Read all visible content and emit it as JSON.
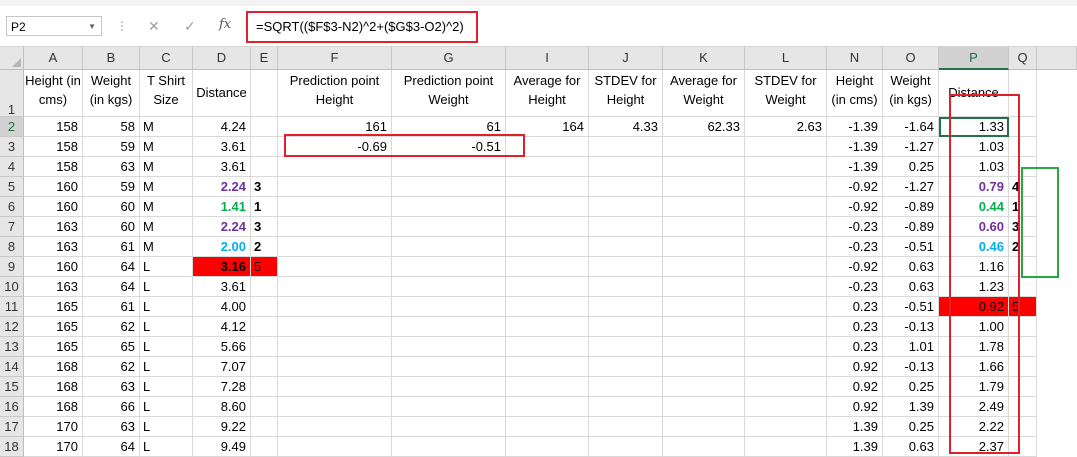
{
  "namebox": {
    "value": "P2"
  },
  "formula_bar": {
    "fx_label": "fx",
    "formula": "=SQRT(($F$3-N2)^2+($G$3-O2)^2)",
    "cancel_icon": "x-icon",
    "enter_icon": "check-icon",
    "highlight_color": "#e0202a"
  },
  "columns": [
    "A",
    "B",
    "C",
    "D",
    "E",
    "F",
    "G",
    "I",
    "J",
    "K",
    "L",
    "N",
    "O",
    "P",
    "Q"
  ],
  "selected_column": "P",
  "selected_row": "2",
  "row_numbers": [
    "1",
    "2",
    "3",
    "4",
    "5",
    "6",
    "7",
    "8",
    "9",
    "10",
    "11",
    "12",
    "13",
    "14",
    "15",
    "16",
    "17",
    "18"
  ],
  "headers": {
    "A": "Height (in cms)",
    "B": "Weight (in kgs)",
    "C": "T Shirt Size",
    "D": "Distance",
    "F": "Prediction point Height",
    "G": "Prediction point Weight",
    "I": "Average for Height",
    "J": "STDEV for Height",
    "K": "Average for Weight",
    "L": "STDEV for Weight",
    "N": "Height (in cms)",
    "O": "Weight (in kgs)",
    "P": "Distance"
  },
  "rows": [
    {
      "A": "158",
      "B": "58",
      "C": "M",
      "D": "4.24",
      "F": "161",
      "G": "61",
      "I": "164",
      "J": "4.33",
      "K": "62.33",
      "L": "2.63",
      "N": "-1.39",
      "O": "-1.64",
      "P": "1.33"
    },
    {
      "A": "158",
      "B": "59",
      "C": "M",
      "D": "3.61",
      "F": "-0.69",
      "G": "-0.51",
      "N": "-1.39",
      "O": "-1.27",
      "P": "1.03"
    },
    {
      "A": "158",
      "B": "63",
      "C": "M",
      "D": "3.61",
      "N": "-1.39",
      "O": "0.25",
      "P": "1.03"
    },
    {
      "A": "160",
      "B": "59",
      "C": "M",
      "D": "2.24",
      "E": "3",
      "N": "-0.92",
      "O": "-1.27",
      "P": "0.79",
      "Q": "4"
    },
    {
      "A": "160",
      "B": "60",
      "C": "M",
      "D": "1.41",
      "E": "1",
      "N": "-0.92",
      "O": "-0.89",
      "P": "0.44",
      "Q": "1"
    },
    {
      "A": "163",
      "B": "60",
      "C": "M",
      "D": "2.24",
      "E": "3",
      "N": "-0.23",
      "O": "-0.89",
      "P": "0.60",
      "Q": "3"
    },
    {
      "A": "163",
      "B": "61",
      "C": "M",
      "D": "2.00",
      "E": "2",
      "N": "-0.23",
      "O": "-0.51",
      "P": "0.46",
      "Q": "2"
    },
    {
      "A": "160",
      "B": "64",
      "C": "L",
      "D": "3.16",
      "E": "5",
      "N": "-0.92",
      "O": "0.63",
      "P": "1.16"
    },
    {
      "A": "163",
      "B": "64",
      "C": "L",
      "D": "3.61",
      "N": "-0.23",
      "O": "0.63",
      "P": "1.23"
    },
    {
      "A": "165",
      "B": "61",
      "C": "L",
      "D": "4.00",
      "N": "0.23",
      "O": "-0.51",
      "P": "0.92",
      "Q": "5"
    },
    {
      "A": "165",
      "B": "62",
      "C": "L",
      "D": "4.12",
      "N": "0.23",
      "O": "-0.13",
      "P": "1.00"
    },
    {
      "A": "165",
      "B": "65",
      "C": "L",
      "D": "5.66",
      "N": "0.23",
      "O": "1.01",
      "P": "1.78"
    },
    {
      "A": "168",
      "B": "62",
      "C": "L",
      "D": "7.07",
      "N": "0.92",
      "O": "-0.13",
      "P": "1.66"
    },
    {
      "A": "168",
      "B": "63",
      "C": "L",
      "D": "7.28",
      "N": "0.92",
      "O": "0.25",
      "P": "1.79"
    },
    {
      "A": "168",
      "B": "66",
      "C": "L",
      "D": "8.60",
      "N": "0.92",
      "O": "1.39",
      "P": "2.49"
    },
    {
      "A": "170",
      "B": "63",
      "C": "L",
      "D": "9.22",
      "N": "1.39",
      "O": "0.25",
      "P": "2.22"
    },
    {
      "A": "170",
      "B": "64",
      "C": "L",
      "D": "9.49",
      "N": "1.39",
      "O": "0.63",
      "P": "2.37"
    }
  ],
  "cell_styles": [
    {
      "row": "5",
      "col": "D",
      "color": "#7030a0",
      "bold": true
    },
    {
      "row": "6",
      "col": "D",
      "color": "#00b050",
      "bold": true
    },
    {
      "row": "7",
      "col": "D",
      "color": "#7030a0",
      "bold": true
    },
    {
      "row": "8",
      "col": "D",
      "color": "#00b0f0",
      "bold": true
    },
    {
      "row": "9",
      "col": "D",
      "bg": "#ff0000",
      "bold": true
    },
    {
      "row": "9",
      "col": "E",
      "bg": "#ff0000"
    },
    {
      "row": "5",
      "col": "E",
      "bold": true
    },
    {
      "row": "6",
      "col": "E",
      "bold": true
    },
    {
      "row": "7",
      "col": "E",
      "bold": true
    },
    {
      "row": "8",
      "col": "E",
      "bold": true
    },
    {
      "row": "5",
      "col": "P",
      "color": "#7030a0",
      "bold": true
    },
    {
      "row": "6",
      "col": "P",
      "color": "#00b050",
      "bold": true
    },
    {
      "row": "7",
      "col": "P",
      "color": "#7030a0",
      "bold": true
    },
    {
      "row": "8",
      "col": "P",
      "color": "#00b0f0",
      "bold": true
    },
    {
      "row": "11",
      "col": "P",
      "bg": "#ff0000"
    },
    {
      "row": "11",
      "col": "Q",
      "bg": "#ff0000"
    },
    {
      "row": "5",
      "col": "Q",
      "bold": true
    },
    {
      "row": "6",
      "col": "Q",
      "bold": true
    },
    {
      "row": "7",
      "col": "Q",
      "bold": true
    },
    {
      "row": "8",
      "col": "Q",
      "bold": true
    }
  ],
  "highlights": {
    "red_box_color": "#e0202a",
    "green_box_color": "#27a844"
  }
}
